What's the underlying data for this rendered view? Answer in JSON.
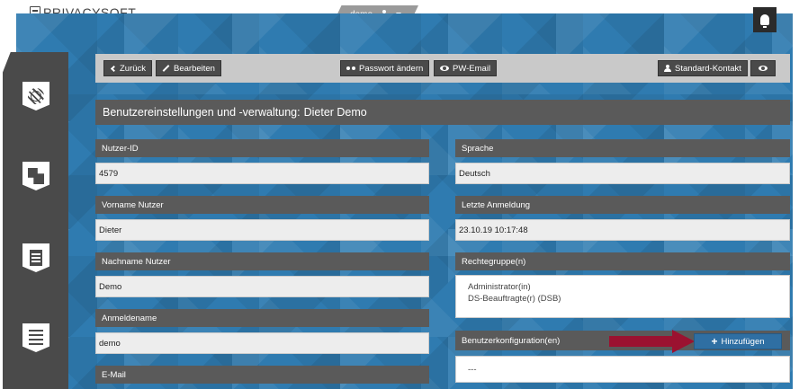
{
  "brand": {
    "name": "PRIVACYSOFT"
  },
  "user_menu": {
    "username": "demo"
  },
  "sidebar": {
    "items": [
      {
        "icon": "globe-shield-icon"
      },
      {
        "icon": "puzzle-icon"
      },
      {
        "icon": "document-icon"
      },
      {
        "icon": "checklist-icon"
      }
    ]
  },
  "toolbar": {
    "back_label": "Zurück",
    "edit_label": "Bearbeiten",
    "password_label": "Passwort ändern",
    "pw_email_label": "PW-Email",
    "standard_contact_label": "Standard-Kontakt"
  },
  "page": {
    "title_prefix": "Benutzereinstellungen und -verwaltung:",
    "title_name": "Dieter Demo"
  },
  "fields": {
    "user_id": {
      "label": "Nutzer-ID",
      "value": "4579"
    },
    "first_name": {
      "label": "Vorname Nutzer",
      "value": "Dieter"
    },
    "last_name": {
      "label": "Nachname Nutzer",
      "value": "Demo"
    },
    "login_name": {
      "label": "Anmeldename",
      "value": "demo"
    },
    "email": {
      "label": "E-Mail"
    },
    "language": {
      "label": "Sprache",
      "value": "Deutsch"
    },
    "last_login": {
      "label": "Letzte Anmeldung",
      "value": "23.10.19 10:17:48"
    },
    "rights_group": {
      "label": "Rechtegruppe(n)",
      "values": [
        "Administrator(in)",
        "DS-Beauftragte(r) (DSB)"
      ]
    },
    "user_config": {
      "label": "Benutzerkonfiguration(en)",
      "value": "---",
      "add_label": "Hinzufügen"
    }
  },
  "colors": {
    "accent_blue": "#2f6fa3",
    "annotation_arrow": "#9b1230",
    "panel_dark": "#5a5a5a",
    "background_blue": "#2f7bb0"
  }
}
